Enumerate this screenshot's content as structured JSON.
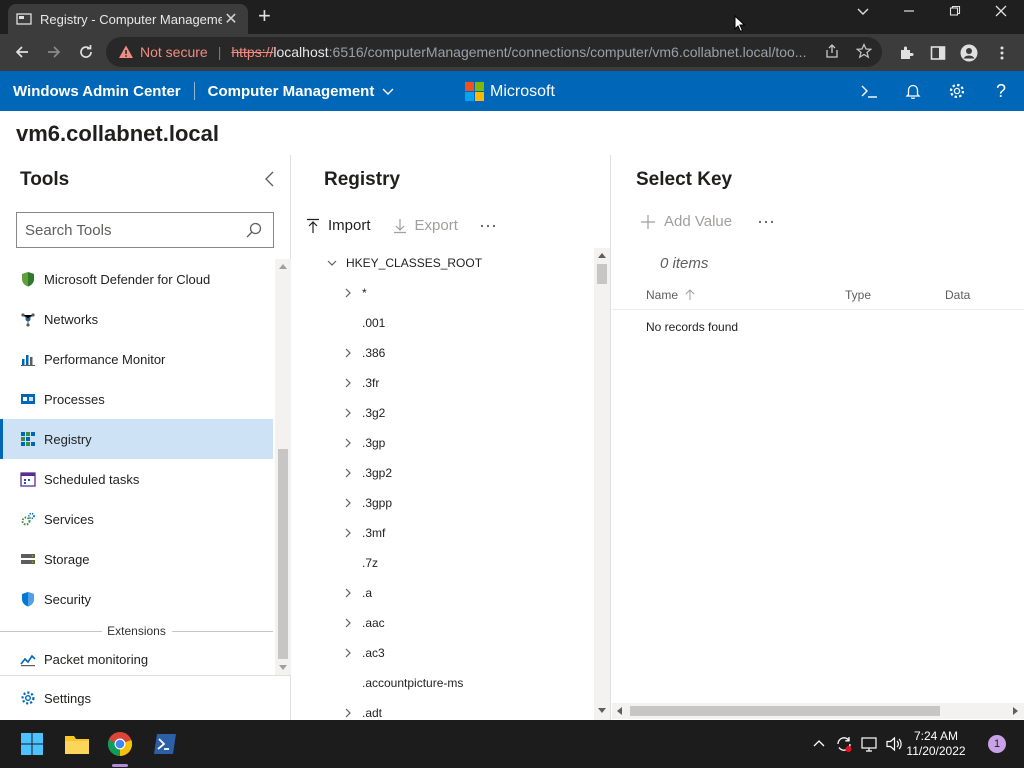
{
  "browser": {
    "tab_title": "Registry - Computer Management",
    "not_secure": "Not secure",
    "url_scheme": "https://",
    "url_host": "localhost",
    "url_rest": ":6516/computerManagement/connections/computer/vm6.collabnet.local/too..."
  },
  "header": {
    "product": "Windows Admin Center",
    "app": "Computer Management",
    "brand": "Microsoft"
  },
  "server_name": "vm6.collabnet.local",
  "tools": {
    "title": "Tools",
    "search_placeholder": "Search Tools",
    "items": [
      {
        "label": "Microsoft Defender for Cloud",
        "icon": "defender-shield-icon"
      },
      {
        "label": "Networks",
        "icon": "networks-icon"
      },
      {
        "label": "Performance Monitor",
        "icon": "performance-chart-icon"
      },
      {
        "label": "Processes",
        "icon": "processes-icon"
      },
      {
        "label": "Registry",
        "icon": "registry-icon",
        "active": true
      },
      {
        "label": "Scheduled tasks",
        "icon": "calendar-icon"
      },
      {
        "label": "Services",
        "icon": "services-gear-icon"
      },
      {
        "label": "Storage",
        "icon": "storage-icon"
      },
      {
        "label": "Security",
        "icon": "security-shield-icon"
      }
    ],
    "extensions_label": "Extensions",
    "extension_items": [
      {
        "label": "Packet monitoring",
        "icon": "packet-monitor-icon"
      }
    ],
    "settings_label": "Settings"
  },
  "registry": {
    "title": "Registry",
    "import_label": "Import",
    "export_label": "Export",
    "root": "HKEY_CLASSES_ROOT",
    "keys": [
      {
        "name": "*",
        "expandable": true
      },
      {
        "name": ".001",
        "expandable": false
      },
      {
        "name": ".386",
        "expandable": true
      },
      {
        "name": ".3fr",
        "expandable": true
      },
      {
        "name": ".3g2",
        "expandable": true
      },
      {
        "name": ".3gp",
        "expandable": true
      },
      {
        "name": ".3gp2",
        "expandable": true
      },
      {
        "name": ".3gpp",
        "expandable": true
      },
      {
        "name": ".3mf",
        "expandable": true
      },
      {
        "name": ".7z",
        "expandable": false
      },
      {
        "name": ".a",
        "expandable": true
      },
      {
        "name": ".aac",
        "expandable": true
      },
      {
        "name": ".ac3",
        "expandable": true
      },
      {
        "name": ".accountpicture-ms",
        "expandable": false
      },
      {
        "name": ".adt",
        "expandable": true
      }
    ]
  },
  "select_key": {
    "title": "Select Key",
    "add_value_label": "Add Value",
    "items_count": "0 items",
    "columns": {
      "name": "Name",
      "type": "Type",
      "data": "Data"
    },
    "empty_text": "No records found"
  },
  "taskbar": {
    "time": "7:24 AM",
    "date": "11/20/2022",
    "notification_count": "1"
  },
  "colors": {
    "accent": "#0067b8",
    "active_item": "#cde3f5",
    "browser_dark": "#3c3c3c",
    "taskbar": "#1c1c1c"
  }
}
